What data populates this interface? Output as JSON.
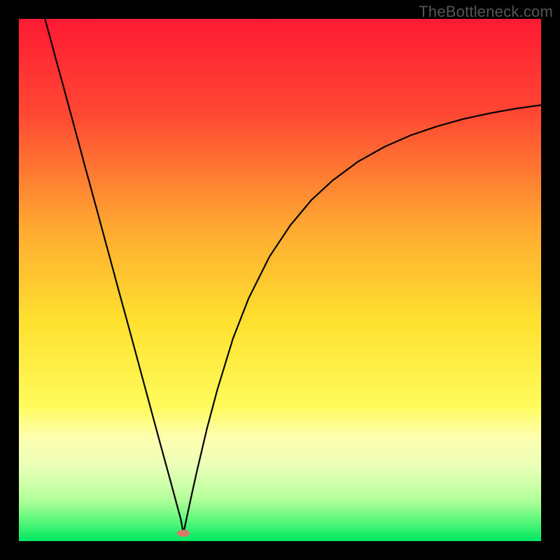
{
  "watermark": "TheBottleneck.com",
  "chart_data": {
    "type": "line",
    "title": "",
    "xlabel": "",
    "ylabel": "",
    "xlim": [
      0,
      100
    ],
    "ylim": [
      0,
      100
    ],
    "background_gradient": {
      "stops": [
        {
          "pos": 0.0,
          "color": "#ff1a33"
        },
        {
          "pos": 0.18,
          "color": "#ff4733"
        },
        {
          "pos": 0.4,
          "color": "#ffa931"
        },
        {
          "pos": 0.58,
          "color": "#ffe12f"
        },
        {
          "pos": 0.74,
          "color": "#fffb5a"
        },
        {
          "pos": 0.8,
          "color": "#ffffb0"
        },
        {
          "pos": 0.86,
          "color": "#e8ffb8"
        },
        {
          "pos": 0.92,
          "color": "#b4ff9a"
        },
        {
          "pos": 0.96,
          "color": "#5cf87d"
        },
        {
          "pos": 1.0,
          "color": "#00e763"
        }
      ]
    },
    "min_marker": {
      "x": 31.5,
      "y": 1.5,
      "color": "#d87a6a"
    },
    "series": [
      {
        "name": "curve",
        "color": "#000000",
        "x": [
          5.0,
          7.0,
          9.0,
          11.0,
          13.0,
          15.0,
          17.0,
          19.0,
          21.0,
          23.0,
          25.0,
          27.0,
          29.0,
          30.0,
          31.0,
          31.5,
          32.0,
          33.0,
          34.0,
          36.0,
          38.0,
          41.0,
          44.0,
          48.0,
          52.0,
          56.0,
          60.0,
          65.0,
          70.0,
          75.0,
          80.0,
          85.0,
          90.0,
          95.0,
          100.0
        ],
        "y": [
          100.0,
          92.6,
          85.3,
          77.9,
          70.5,
          63.2,
          55.8,
          48.4,
          41.1,
          33.7,
          26.3,
          18.9,
          11.6,
          7.9,
          4.2,
          1.5,
          3.8,
          8.5,
          13.0,
          21.5,
          29.0,
          38.8,
          46.5,
          54.5,
          60.5,
          65.3,
          69.0,
          72.7,
          75.5,
          77.7,
          79.4,
          80.8,
          81.9,
          82.8,
          83.5
        ]
      }
    ]
  }
}
